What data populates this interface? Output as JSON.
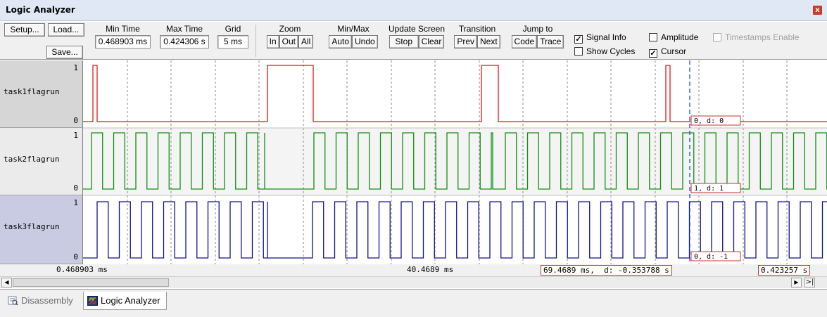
{
  "window": {
    "title": "Logic Analyzer",
    "close_label": "x"
  },
  "toolbar": {
    "setup": "Setup...",
    "load": "Load...",
    "save": "Save...",
    "min_time": {
      "caption": "Min Time",
      "value": "0.468903 ms"
    },
    "max_time": {
      "caption": "Max Time",
      "value": "0.424306 s"
    },
    "grid": {
      "caption": "Grid",
      "value": "5 ms"
    },
    "zoom": {
      "caption": "Zoom",
      "in": "In",
      "out": "Out",
      "all": "All"
    },
    "minmax": {
      "caption": "Min/Max",
      "auto": "Auto",
      "undo": "Undo"
    },
    "update": {
      "caption": "Update Screen",
      "stop": "Stop",
      "clear": "Clear"
    },
    "transition": {
      "caption": "Transition",
      "prev": "Prev",
      "next": "Next"
    },
    "jumpto": {
      "caption": "Jump to",
      "code": "Code",
      "trace": "Trace"
    },
    "options": {
      "signal_info": {
        "label": "Signal Info",
        "checked": true
      },
      "amplitude": {
        "label": "Amplitude",
        "checked": false
      },
      "timestamps": {
        "label": "Timestamps Enable",
        "checked": false,
        "disabled": true
      },
      "show_cycles": {
        "label": "Show Cycles",
        "checked": false
      },
      "cursor": {
        "label": "Cursor",
        "checked": true
      }
    }
  },
  "signals": [
    {
      "name": "task1flagrun",
      "high": "1",
      "low": "0",
      "color": "#e01818",
      "cursor_info": "0,  d: 0"
    },
    {
      "name": "task2flagrun",
      "high": "1",
      "low": "0",
      "color": "#109010",
      "cursor_info": "1,  d: 1"
    },
    {
      "name": "task3flagrun",
      "high": "1",
      "low": "0",
      "color": "#10108c",
      "cursor_info": "0,  d: -1"
    }
  ],
  "timeline": {
    "left": "0.468903 ms",
    "center": "40.4689 ms",
    "cursor": "69.4689 ms,  d: -0.353788 s",
    "right": "0.423257 s"
  },
  "tabs": [
    {
      "label": "Disassembly",
      "active": false
    },
    {
      "label": "Logic Analyzer",
      "active": true
    }
  ]
}
